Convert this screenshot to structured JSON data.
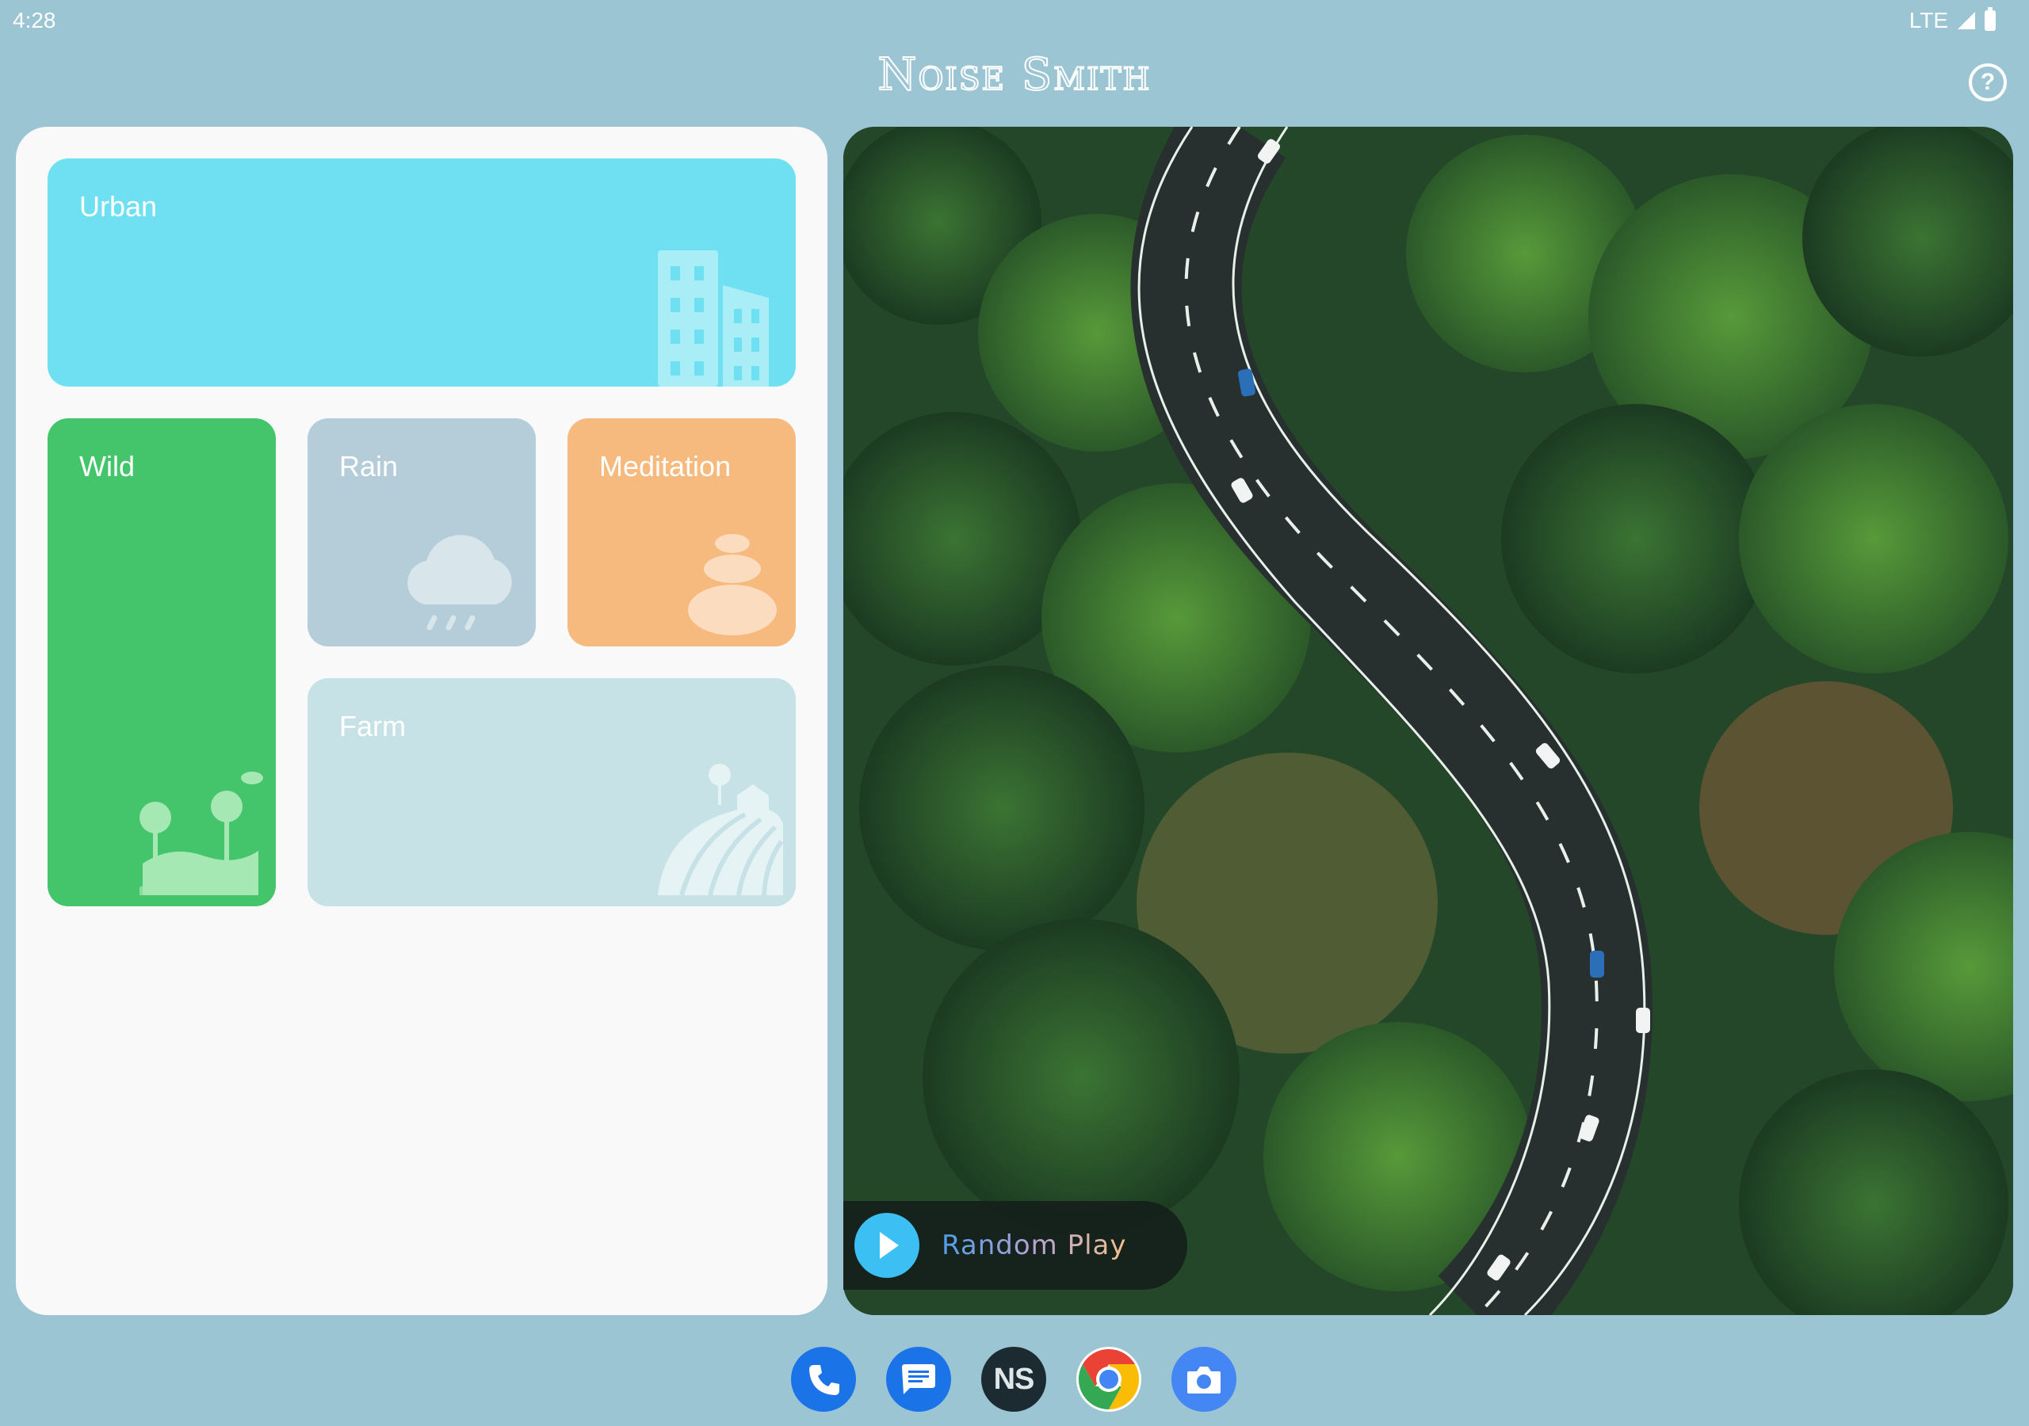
{
  "status_bar": {
    "time": "4:28",
    "network": "LTE"
  },
  "header": {
    "title": "Noise Smith",
    "help_symbol": "?"
  },
  "categories": [
    {
      "label": "Urban",
      "color": "#6fe0f2",
      "icon": "buildings-icon"
    },
    {
      "label": "Wild",
      "color": "#44c56b",
      "icon": "trees-landscape-icon"
    },
    {
      "label": "Rain",
      "color": "#b5cdd8",
      "icon": "rain-cloud-icon"
    },
    {
      "label": "Meditation",
      "color": "#f6b97e",
      "icon": "stacked-stones-icon"
    },
    {
      "label": "Farm",
      "color": "#c6e2e7",
      "icon": "farm-field-icon"
    }
  ],
  "hero": {
    "random_play_label": "Random Play"
  },
  "dock": {
    "apps": [
      {
        "name": "phone-icon"
      },
      {
        "name": "messages-icon"
      },
      {
        "name": "noise-smith-icon",
        "label": "NS"
      },
      {
        "name": "chrome-icon"
      },
      {
        "name": "camera-icon"
      }
    ]
  },
  "colors": {
    "background": "#9cc5d3",
    "panel": "#f9f9f9",
    "accent": "#3cc0f4"
  }
}
